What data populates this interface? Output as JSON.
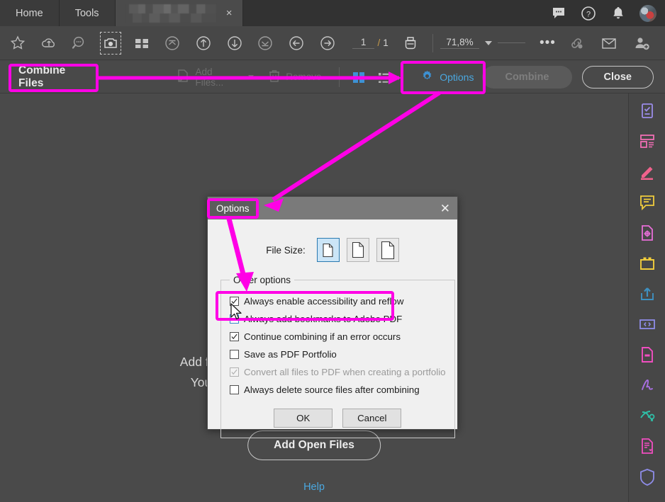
{
  "app": {
    "menu": [
      {
        "label": "Home",
        "name": "menu-home"
      },
      {
        "label": "Tools",
        "name": "menu-tools"
      }
    ],
    "document_tab": {
      "title": "",
      "close_label": "×"
    },
    "topbar_icons": [
      "comment-bubble-icon",
      "help-circle-icon",
      "bell-icon",
      "avatar"
    ]
  },
  "toolbar": {
    "icons": [
      "star-icon",
      "cloud-upload-icon",
      "search-icon",
      "snapshot-camera-icon",
      "compare-files-icon",
      "first-page-icon",
      "previous-page-icon",
      "next-page-icon",
      "last-page-icon",
      "back-arrow-icon",
      "forward-arrow-icon"
    ],
    "page_current": "1",
    "page_separator": "/",
    "page_total": "1",
    "print_icon": "print-icon",
    "zoom_level": "71,8%",
    "more_label": "•••",
    "right_icons": [
      "link-share-icon",
      "email-icon",
      "add-person-icon"
    ]
  },
  "combine_bar": {
    "title": "Combine Files",
    "add_files_label": "Add Files...",
    "remove_label": "Remove",
    "view_grid_icon": "grid-view-icon",
    "view_list_icon": "list-view-icon",
    "options_label": "Options",
    "combine_label": "Combine",
    "close_label": "Close"
  },
  "canvas": {
    "drop_line1": "Add files by clicking Add Files or drag them here.",
    "drop_line2": "You can also add files from open documents.",
    "add_open_files_label": "Add Open Files",
    "help_label": "Help"
  },
  "sidebar": {
    "items": [
      {
        "name": "sidebar-item-prepare-form",
        "icon": "checklist-form-icon",
        "color": "#9b8ce8"
      },
      {
        "name": "sidebar-item-organize-pages",
        "icon": "organize-pages-icon",
        "color": "#f06eb4"
      },
      {
        "name": "sidebar-item-edit-pdf",
        "icon": "edit-pencil-icon",
        "color": "#f0628c"
      },
      {
        "name": "sidebar-item-comment",
        "icon": "comment-icon",
        "color": "#f0cc3c"
      },
      {
        "name": "sidebar-item-redact",
        "icon": "redact-doc-icon",
        "color": "#e86ed8"
      },
      {
        "name": "sidebar-item-combine-files",
        "icon": "combine-folder-icon",
        "color": "#f0cc3c"
      },
      {
        "name": "sidebar-item-share",
        "icon": "share-upload-icon",
        "color": "#3e90c0"
      },
      {
        "name": "sidebar-item-action-wizard",
        "icon": "code-brackets-icon",
        "color": "#8e8ce8"
      },
      {
        "name": "sidebar-item-compress-pdf",
        "icon": "compress-doc-icon",
        "color": "#f04ec0"
      },
      {
        "name": "sidebar-item-fill-sign",
        "icon": "signature-icon",
        "color": "#a86ee0"
      },
      {
        "name": "sidebar-item-certificates",
        "icon": "certificate-icon",
        "color": "#2ec0a8"
      },
      {
        "name": "sidebar-item-protect",
        "icon": "protect-doc-icon",
        "color": "#f04ec0"
      },
      {
        "name": "sidebar-item-shield",
        "icon": "shield-icon",
        "color": "#8e8ce8"
      }
    ]
  },
  "dialog": {
    "title": "Options",
    "close_label": "✕",
    "file_size_label": "File Size:",
    "file_size_options": [
      {
        "name": "file-size-smallest",
        "selected": true
      },
      {
        "name": "file-size-default",
        "selected": false
      },
      {
        "name": "file-size-largest",
        "selected": false
      }
    ],
    "group_legend": "Other options",
    "checkboxes": [
      {
        "label": "Always enable accessibility and reflow",
        "checked": true,
        "disabled": false,
        "name": "checkbox-accessibility-reflow"
      },
      {
        "label": "Always add bookmarks to Adobe PDF",
        "checked": false,
        "disabled": false,
        "name": "checkbox-add-bookmarks"
      },
      {
        "label": "Continue combining if an error occurs",
        "checked": true,
        "disabled": false,
        "name": "checkbox-continue-on-error"
      },
      {
        "label": "Save as PDF Portfolio",
        "checked": false,
        "disabled": false,
        "name": "checkbox-save-as-portfolio"
      },
      {
        "label": "Convert all files to PDF when creating a portfolio",
        "checked": true,
        "disabled": true,
        "name": "checkbox-convert-all-files"
      },
      {
        "label": "Always delete source files after combining",
        "checked": false,
        "disabled": false,
        "name": "checkbox-delete-source-files"
      }
    ],
    "ok_label": "OK",
    "cancel_label": "Cancel"
  },
  "annotations": {
    "accent_color": "#ff00e6",
    "tag_combine_files": "Combine Files",
    "tag_options_dialog": "Options"
  }
}
